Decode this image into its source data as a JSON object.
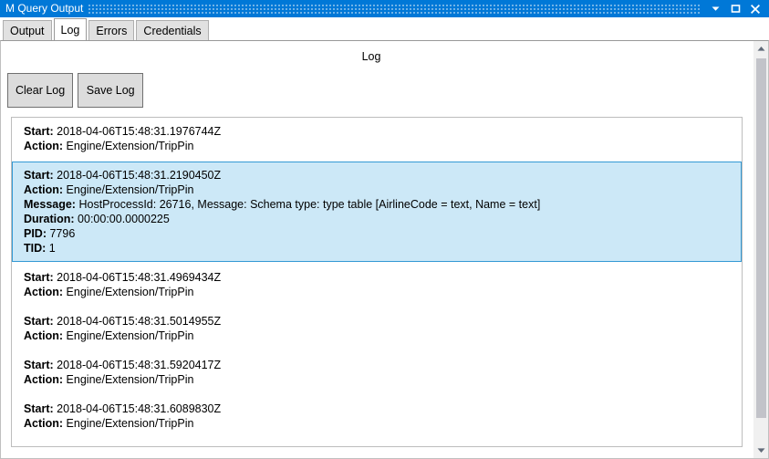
{
  "window": {
    "title": "M Query Output",
    "controls": {
      "minimize_label": "Minimize",
      "maximize_label": "Maximize",
      "close_label": "Close"
    }
  },
  "tabs": [
    {
      "label": "Output",
      "active": false
    },
    {
      "label": "Log",
      "active": true
    },
    {
      "label": "Errors",
      "active": false
    },
    {
      "label": "Credentials",
      "active": false
    }
  ],
  "panel": {
    "heading": "Log",
    "buttons": {
      "clear_log": "Clear Log",
      "save_log": "Save Log"
    }
  },
  "labels": {
    "start": "Start:",
    "action": "Action:",
    "message": "Message:",
    "duration": "Duration:",
    "pid": "PID:",
    "tid": "TID:"
  },
  "log_entries": [
    {
      "selected": false,
      "start": "2018-04-06T15:48:31.1976744Z",
      "action": "Engine/Extension/TripPin"
    },
    {
      "selected": true,
      "start": "2018-04-06T15:48:31.2190450Z",
      "action": "Engine/Extension/TripPin",
      "message": "HostProcessId: 26716, Message: Schema type: type table [AirlineCode = text, Name = text]",
      "duration": "00:00:00.0000225",
      "pid": "7796",
      "tid": "1"
    },
    {
      "selected": false,
      "start": "2018-04-06T15:48:31.4969434Z",
      "action": "Engine/Extension/TripPin"
    },
    {
      "selected": false,
      "start": "2018-04-06T15:48:31.5014955Z",
      "action": "Engine/Extension/TripPin"
    },
    {
      "selected": false,
      "start": "2018-04-06T15:48:31.5920417Z",
      "action": "Engine/Extension/TripPin"
    },
    {
      "selected": false,
      "start": "2018-04-06T15:48:31.6089830Z",
      "action": "Engine/Extension/TripPin"
    }
  ],
  "scrollbar": {
    "up_icon": "triangle-up-icon",
    "down_icon": "triangle-down-icon"
  },
  "colors": {
    "titlebar": "#0078d7",
    "selection_fill": "#cce8f7",
    "selection_border": "#3399d4",
    "button_face": "#dcdcdc"
  }
}
